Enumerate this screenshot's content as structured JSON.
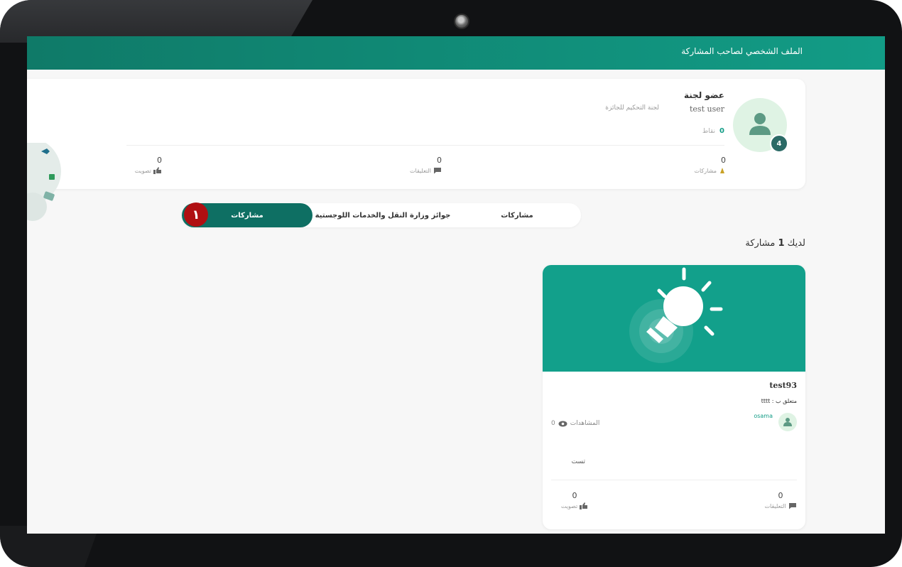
{
  "header": {
    "title": "الملف الشخصي لصاحب المشاركة"
  },
  "profile": {
    "role": "عضو لجنة",
    "name": "test user",
    "committee": "لجنة التحكيم للجائزة",
    "points_value": "0",
    "points_label": "نقاط",
    "badge": "4",
    "stats": [
      {
        "value": "0",
        "label": "مشاركات",
        "icon": "hand-pointer-icon"
      },
      {
        "value": "0",
        "label": "التعليقات",
        "icon": "comment-icon"
      },
      {
        "value": "0",
        "label": "تصويت",
        "icon": "thumbs-up-icon"
      }
    ]
  },
  "tabs": [
    {
      "label": "مشاركات"
    },
    {
      "label": "جوائز وزارة النقل والخدمات اللوجستية"
    },
    {
      "label": "مشاركات"
    }
  ],
  "marker": "١",
  "summary": {
    "prefix": "لديك",
    "count": "1",
    "suffix": "مشاركة"
  },
  "post": {
    "title": "test93",
    "related_label": "متعلق ب : tttt",
    "author": "osama",
    "views_label": "المشاهدات",
    "views_value": "0",
    "body": "تست",
    "comments_value": "0",
    "comments_label": "التعليقات",
    "votes_value": "0",
    "votes_label": "تصويت"
  },
  "colors": {
    "primary": "#129c86",
    "active_tab": "#0e6f63",
    "marker": "#b00f12"
  }
}
